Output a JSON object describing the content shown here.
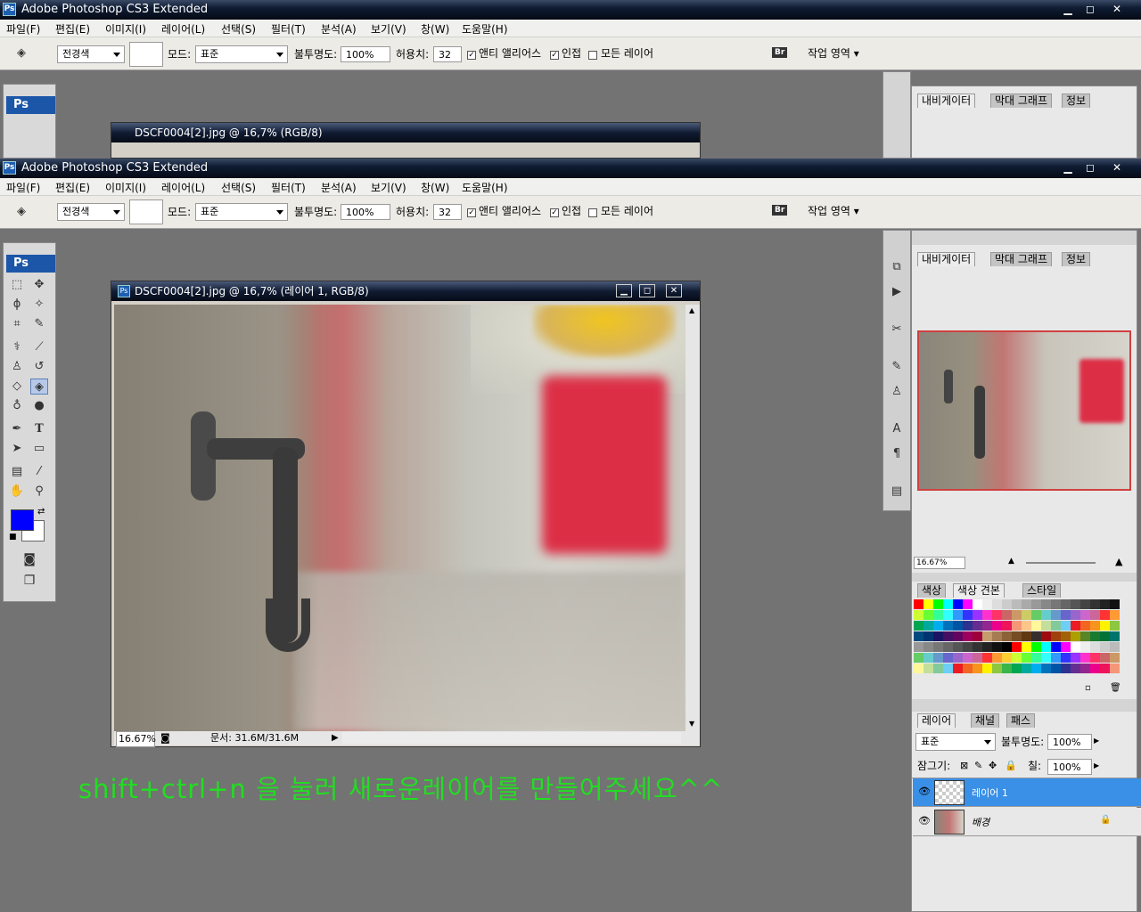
{
  "app_title": "Adobe Photoshop CS3 Extended",
  "ps_logo": "Ps",
  "window_controls": {
    "minimize": "▁",
    "maximize": "◻",
    "close": "✕"
  },
  "menu": [
    "파일(F)",
    "편집(E)",
    "이미지(I)",
    "레이어(L)",
    "선택(S)",
    "필터(T)",
    "분석(A)",
    "보기(V)",
    "창(W)",
    "도움말(H)"
  ],
  "options": {
    "fill_source": "전경색",
    "mode_label": "모드:",
    "mode_value": "표준",
    "opacity_label": "불투명도:",
    "opacity_value": "100%",
    "tolerance_label": "허용치:",
    "tolerance_value": "32",
    "anti_alias_label": "앤티 앨리어스",
    "anti_alias_checked": "✓",
    "contiguous_label": "인접",
    "contiguous_checked": "✓",
    "all_layers_label": "모든 레이어",
    "workspace_label": "작업 영역 ▾",
    "bridge_icon": "Br"
  },
  "back_window": {
    "doc_title": "DSCF0004[2].jpg @ 16,7% (RGB/8)"
  },
  "document": {
    "title": "DSCF0004[2].jpg @ 16,7% (레이어 1, RGB/8)",
    "zoom": "16.67%",
    "doc_info": "문서: 31.6M/31.6M"
  },
  "colors": {
    "foreground": "#0000ff",
    "background": "#ffffff",
    "highlight_layer": "#3a8fe6",
    "instruction_text": "#22dd22"
  },
  "instruction": "shift+ctrl+n 을 눌러 새로운레이어를 만들어주세요^^",
  "navigator": {
    "tabs": [
      "내비게이터",
      "막대 그래프",
      "정보"
    ],
    "zoom": "16.67%"
  },
  "swatches_panel": {
    "tabs": [
      "색상",
      "색상 견본",
      "스타일"
    ]
  },
  "layers_panel": {
    "tabs": [
      "레이어",
      "채널",
      "패스"
    ],
    "blend_mode": "표준",
    "opacity_label": "불투명도:",
    "opacity_value": "100%",
    "lock_label": "잠그기:",
    "fill_label": "칠:",
    "fill_value": "100%",
    "layers": [
      {
        "name": "레이어 1",
        "selected": true
      },
      {
        "name": "배경",
        "selected": false,
        "locked": true
      }
    ]
  }
}
